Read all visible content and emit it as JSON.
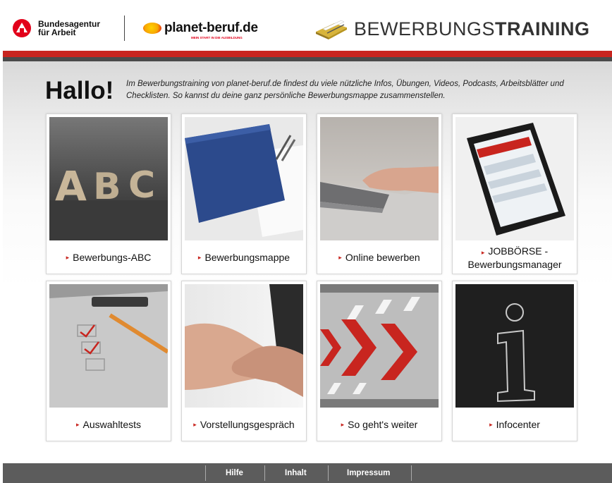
{
  "header": {
    "ba_logo_line1": "Bundesagentur",
    "ba_logo_line2": "für Arbeit",
    "pb_logo_name": "planet-beruf.de",
    "pb_logo_tagline": "MEIN START IN DIE AUSBILDUNG",
    "bt_logo_light": "BEWERBUNGS",
    "bt_logo_bold": "TRAINING"
  },
  "intro": {
    "greeting": "Hallo!",
    "text": "Im Bewerbungstraining von planet-beruf.de findest du viele nützliche Infos, Übungen, Videos, Podcasts, Arbeitsblätter und Checklisten. So kannst du deine ganz persönliche Bewerbungsmappe zusammenstellen."
  },
  "tiles": [
    {
      "label": "Bewerbungs-ABC"
    },
    {
      "label": "Bewerbungsmappe"
    },
    {
      "label": "Online bewerben"
    },
    {
      "label": "JOBBÖRSE -\nBewerbungsmanager"
    },
    {
      "label": "Auswahltests"
    },
    {
      "label": "Vorstellungsgespräch"
    },
    {
      "label": "So geht's weiter"
    },
    {
      "label": "Infocenter"
    }
  ],
  "footer": {
    "links": [
      "Hilfe",
      "Inhalt",
      "Impressum"
    ]
  },
  "colors": {
    "accent_red": "#c8251f",
    "ba_red": "#e2001a",
    "footer_bg": "#5c5c5c"
  },
  "icons": {
    "ba_logo": "bundesagentur-logo-icon",
    "pb_logo": "planet-icon",
    "bt_logo": "folder-pen-icon",
    "tile_arrow": "triangle-right-icon"
  }
}
